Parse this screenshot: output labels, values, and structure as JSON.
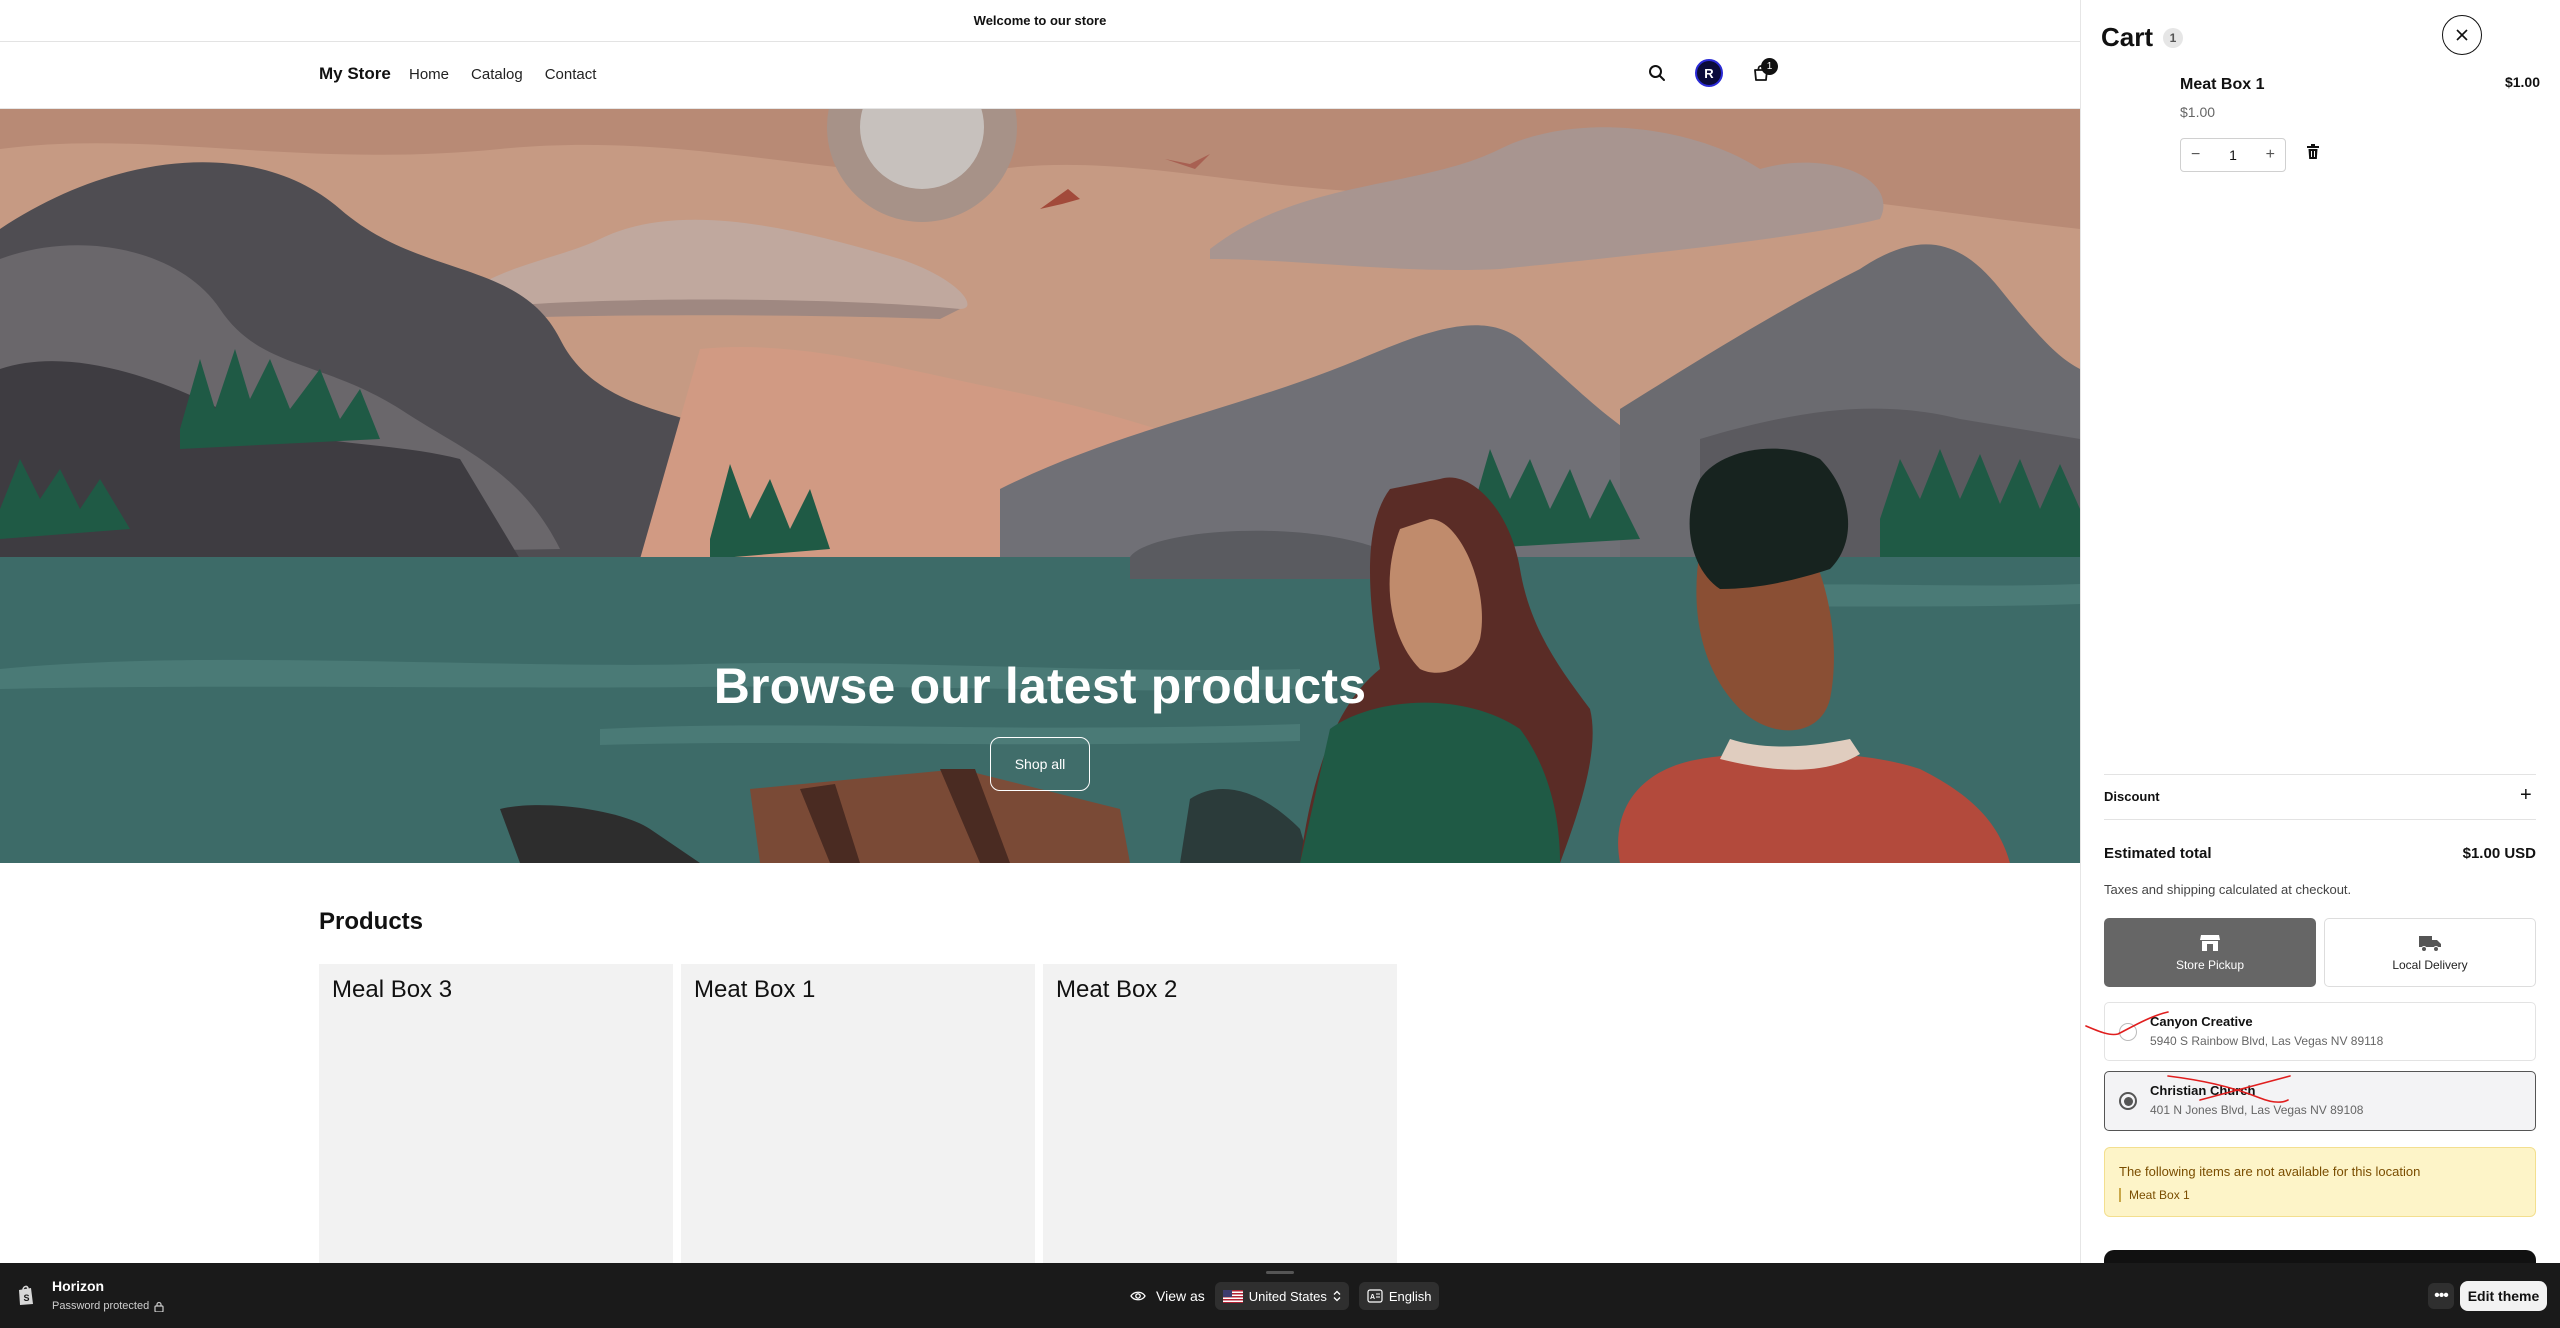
{
  "announcement": "Welcome to our store",
  "header": {
    "logo": "My Store",
    "nav": [
      "Home",
      "Catalog",
      "Contact"
    ],
    "avatar_initial": "R",
    "cart_badge": "1"
  },
  "hero": {
    "title": "Browse our latest products",
    "button": "Shop all"
  },
  "products": {
    "title": "Products",
    "items": [
      "Meal Box 3",
      "Meat Box 1",
      "Meat Box 2"
    ]
  },
  "cart": {
    "title": "Cart",
    "count": "1",
    "item": {
      "name": "Meat Box 1",
      "price": "$1.00",
      "total": "$1.00",
      "quantity": "1"
    },
    "discount_label": "Discount",
    "estimated_total_label": "Estimated total",
    "estimated_total_value": "$1.00 USD",
    "tax_note": "Taxes and shipping calculated at checkout.",
    "shipping_tabs": [
      "Store Pickup",
      "Local Delivery"
    ],
    "locations": [
      {
        "name": "Canyon Creative",
        "address": "5940 S Rainbow Blvd, Las Vegas NV 89118"
      },
      {
        "name": "Christian Church",
        "address": "401 N Jones Blvd, Las Vegas NV 89108"
      }
    ],
    "warning": {
      "message": "The following items are not available for this location",
      "item": "Meat Box 1"
    }
  },
  "bottom_bar": {
    "theme_name": "Horizon",
    "status": "Password protected",
    "view_as": "View as",
    "country": "United States",
    "language": "English",
    "edit_theme": "Edit theme"
  },
  "colors": {
    "sky": "#c69a83",
    "water": "#3d6b68",
    "mountain_dark": "#5c5a5e",
    "tree_green": "#1f5a45",
    "selected_tab": "#666666",
    "warning_bg": "#fdf4c8",
    "annotation_red": "#e01e1e"
  }
}
